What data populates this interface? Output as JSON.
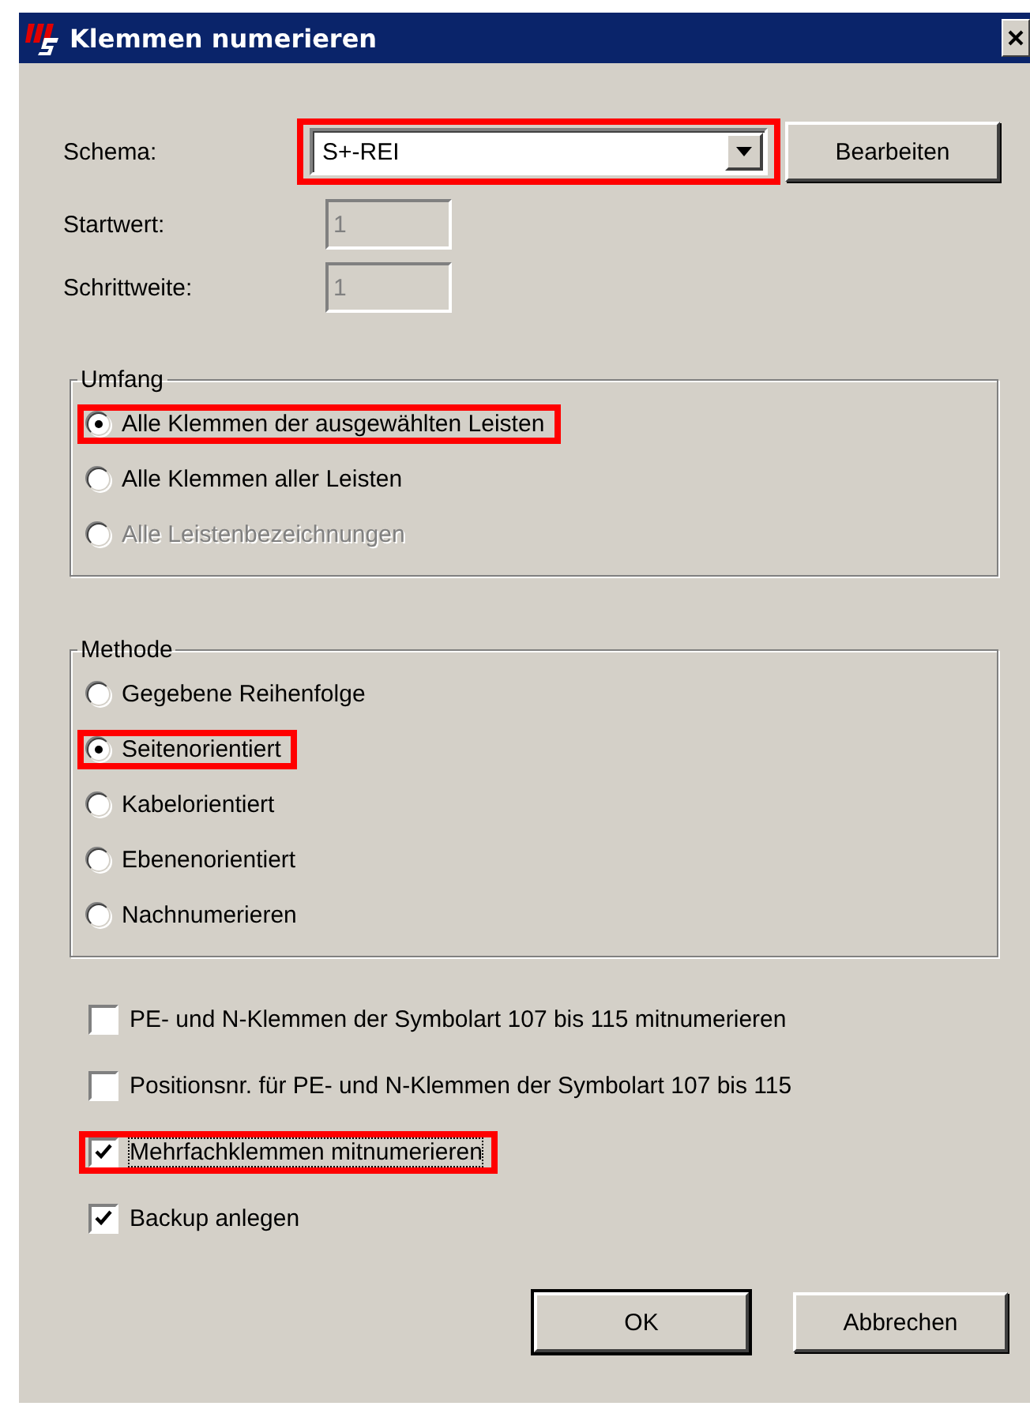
{
  "window": {
    "title": "Klemmen numerieren"
  },
  "fields": [
    {
      "label": "Schema:",
      "value": "S+-REI",
      "kind": "dropdown",
      "disabled": false,
      "highlighted": true
    },
    {
      "label": "Startwert:",
      "value": "1",
      "kind": "text",
      "disabled": true,
      "highlighted": false
    },
    {
      "label": "Schrittweite:",
      "value": "1",
      "kind": "text",
      "disabled": true,
      "highlighted": false
    }
  ],
  "edit_button": "Bearbeiten",
  "groups": [
    {
      "title": "Umfang",
      "options": [
        {
          "label": "Alle Klemmen der ausgewählten Leisten",
          "selected": true,
          "disabled": false,
          "highlighted": true
        },
        {
          "label": "Alle Klemmen aller Leisten",
          "selected": false,
          "disabled": false,
          "highlighted": false
        },
        {
          "label": "Alle Leistenbezeichnungen",
          "selected": false,
          "disabled": true,
          "highlighted": false
        }
      ]
    },
    {
      "title": "Methode",
      "options": [
        {
          "label": "Gegebene Reihenfolge",
          "selected": false,
          "disabled": false,
          "highlighted": false
        },
        {
          "label": "Seitenorientiert",
          "selected": true,
          "disabled": false,
          "highlighted": true
        },
        {
          "label": "Kabelorientiert",
          "selected": false,
          "disabled": false,
          "highlighted": false
        },
        {
          "label": "Ebenenorientiert",
          "selected": false,
          "disabled": false,
          "highlighted": false
        },
        {
          "label": "Nachnumerieren",
          "selected": false,
          "disabled": false,
          "highlighted": false
        }
      ]
    }
  ],
  "checkboxes": [
    {
      "label": "PE- und N-Klemmen der Symbolart 107 bis 115 mitnumerieren",
      "checked": false,
      "highlighted": false,
      "focused": false
    },
    {
      "label": "Positionsnr. für PE- und N-Klemmen der Symbolart 107 bis 115",
      "checked": false,
      "highlighted": false,
      "focused": false
    },
    {
      "label": "Mehrfachklemmen mitnumerieren",
      "checked": true,
      "highlighted": true,
      "focused": true
    },
    {
      "label": "Backup anlegen",
      "checked": true,
      "highlighted": false,
      "focused": false
    }
  ],
  "buttons": [
    {
      "label": "OK",
      "default": true
    },
    {
      "label": "Abbrechen",
      "default": false
    }
  ]
}
